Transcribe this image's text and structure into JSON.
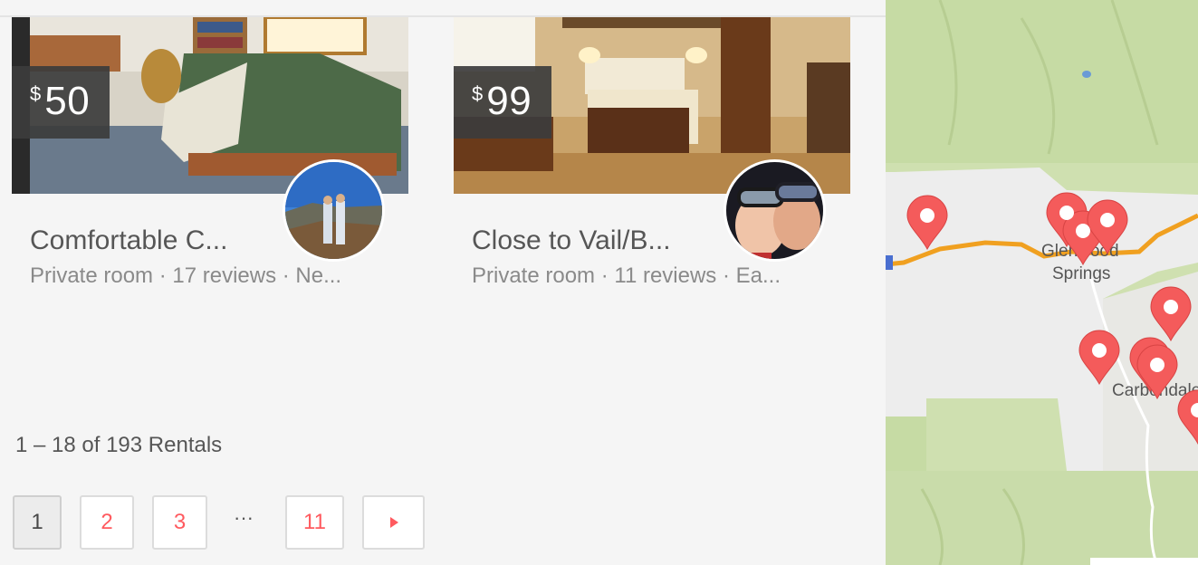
{
  "listings": [
    {
      "currency": "$",
      "price": "50",
      "title": "Comfortable C...",
      "subtitle": "Private room · 17 reviews · Ne..."
    },
    {
      "currency": "$",
      "price": "99",
      "title": "Close to Vail/B...",
      "subtitle": "Private room · 11 reviews · Ea..."
    }
  ],
  "results": {
    "count_text": "1 – 18 of 193 Rentals"
  },
  "pagination": {
    "pages": [
      "1",
      "2",
      "3",
      "11"
    ],
    "ellipsis": "···",
    "current": "1",
    "next_icon": "caret-right-icon"
  },
  "map": {
    "labels": [
      "Glenwood",
      "Springs",
      "Carbondale"
    ],
    "marker_color": "#f45b5b",
    "highway_color": "#f0a020"
  },
  "colors": {
    "accent": "#ff5a5f",
    "text": "#484848",
    "muted": "#8a8a8a"
  }
}
